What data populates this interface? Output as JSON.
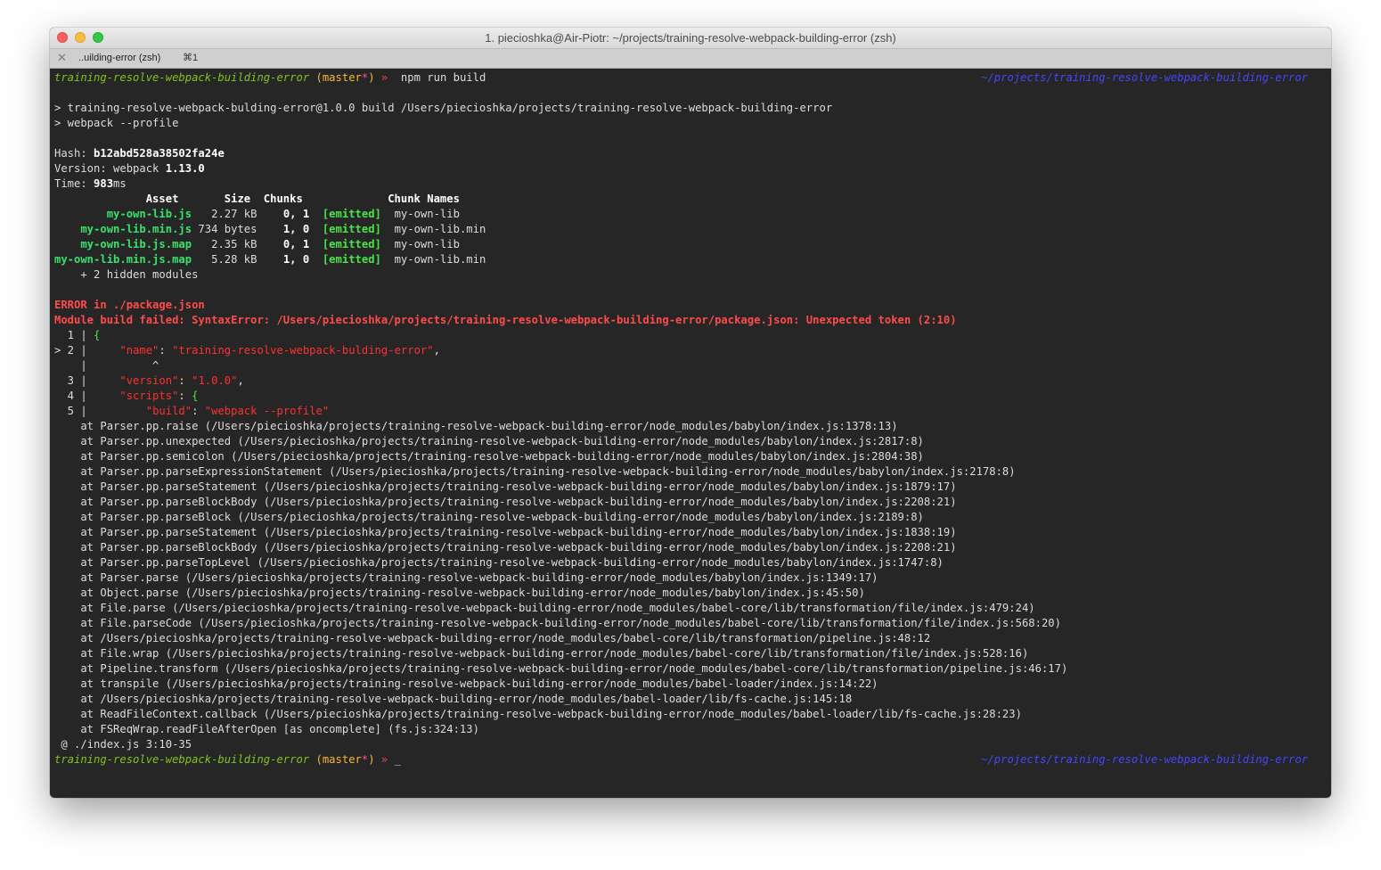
{
  "window": {
    "title": "1. piecioshka@Air-Piotr: ~/projects/training-resolve-webpack-building-error (zsh)"
  },
  "tab": {
    "close": "✕",
    "label": "..uilding-error (zsh)",
    "shortcut": "⌘1"
  },
  "prompt": {
    "dir": "training-resolve-webpack-building-error",
    "branch_open": " (master",
    "dirty": "*",
    "branch_close": ")",
    "arrow": " »",
    "right_path": "~/projects/training-resolve-webpack-building-error",
    "command": "  npm run build"
  },
  "npm": {
    "line1": "> training-resolve-webpack-bulding-error@1.0.0 build /Users/piecioshka/projects/training-resolve-webpack-building-error",
    "line2": "> webpack --profile"
  },
  "stats": {
    "hash_label": "Hash: ",
    "hash": "b12abd528a38502fa24e",
    "version_label": "Version: webpack ",
    "version": "1.13.0",
    "time_label": "Time: ",
    "time_value": "983",
    "time_unit": "ms",
    "header": "              Asset       Size  Chunks             Chunk Names",
    "assets": [
      {
        "name": "        my-own-lib.js",
        "size": "   2.27 kB",
        "chunks": "    0, 1",
        "emitted": "  [emitted]",
        "chunk_name": "  my-own-lib"
      },
      {
        "name": "    my-own-lib.min.js",
        "size": " 734 bytes",
        "chunks": "    1, 0",
        "emitted": "  [emitted]",
        "chunk_name": "  my-own-lib.min"
      },
      {
        "name": "    my-own-lib.js.map",
        "size": "   2.35 kB",
        "chunks": "    0, 1",
        "emitted": "  [emitted]",
        "chunk_name": "  my-own-lib"
      },
      {
        "name": "my-own-lib.min.js.map",
        "size": "   5.28 kB",
        "chunks": "    1, 0",
        "emitted": "  [emitted]",
        "chunk_name": "  my-own-lib.min"
      }
    ],
    "hidden_modules": "    + 2 hidden modules"
  },
  "error": {
    "title": "ERROR in ./package.json",
    "message": "Module build failed: SyntaxError: /Users/piecioshka/projects/training-resolve-webpack-building-error/package.json: Unexpected token (2:10)",
    "code": {
      "l1_prefix": "  1 | ",
      "l1_brace": "{",
      "l2_prefix": "> 2 |     ",
      "l2_key": "\"name\"",
      "l2_colon": ": ",
      "l2_value": "\"training-resolve-webpack-bulding-error\"",
      "l2_end": ",",
      "caret": "    |          ^",
      "l3_prefix": "  3 |     ",
      "l3_key": "\"version\"",
      "l3_colon": ": ",
      "l3_value": "\"1.0.0\"",
      "l3_end": ",",
      "l4_prefix": "  4 |     ",
      "l4_key": "\"scripts\"",
      "l4_colon": ": ",
      "l4_brace": "{",
      "l5_prefix": "  5 |         ",
      "l5_key": "\"build\"",
      "l5_colon": ": ",
      "l5_value": "\"webpack --profile\""
    },
    "stack": [
      "    at Parser.pp.raise (/Users/piecioshka/projects/training-resolve-webpack-building-error/node_modules/babylon/index.js:1378:13)",
      "    at Parser.pp.unexpected (/Users/piecioshka/projects/training-resolve-webpack-building-error/node_modules/babylon/index.js:2817:8)",
      "    at Parser.pp.semicolon (/Users/piecioshka/projects/training-resolve-webpack-building-error/node_modules/babylon/index.js:2804:38)",
      "    at Parser.pp.parseExpressionStatement (/Users/piecioshka/projects/training-resolve-webpack-building-error/node_modules/babylon/index.js:2178:8)",
      "    at Parser.pp.parseStatement (/Users/piecioshka/projects/training-resolve-webpack-building-error/node_modules/babylon/index.js:1879:17)",
      "    at Parser.pp.parseBlockBody (/Users/piecioshka/projects/training-resolve-webpack-building-error/node_modules/babylon/index.js:2208:21)",
      "    at Parser.pp.parseBlock (/Users/piecioshka/projects/training-resolve-webpack-building-error/node_modules/babylon/index.js:2189:8)",
      "    at Parser.pp.parseStatement (/Users/piecioshka/projects/training-resolve-webpack-building-error/node_modules/babylon/index.js:1838:19)",
      "    at Parser.pp.parseBlockBody (/Users/piecioshka/projects/training-resolve-webpack-building-error/node_modules/babylon/index.js:2208:21)",
      "    at Parser.pp.parseTopLevel (/Users/piecioshka/projects/training-resolve-webpack-building-error/node_modules/babylon/index.js:1747:8)",
      "    at Parser.parse (/Users/piecioshka/projects/training-resolve-webpack-building-error/node_modules/babylon/index.js:1349:17)",
      "    at Object.parse (/Users/piecioshka/projects/training-resolve-webpack-building-error/node_modules/babylon/index.js:45:50)",
      "    at File.parse (/Users/piecioshka/projects/training-resolve-webpack-building-error/node_modules/babel-core/lib/transformation/file/index.js:479:24)",
      "    at File.parseCode (/Users/piecioshka/projects/training-resolve-webpack-building-error/node_modules/babel-core/lib/transformation/file/index.js:568:20)",
      "    at /Users/piecioshka/projects/training-resolve-webpack-building-error/node_modules/babel-core/lib/transformation/pipeline.js:48:12",
      "    at File.wrap (/Users/piecioshka/projects/training-resolve-webpack-building-error/node_modules/babel-core/lib/transformation/file/index.js:528:16)",
      "    at Pipeline.transform (/Users/piecioshka/projects/training-resolve-webpack-building-error/node_modules/babel-core/lib/transformation/pipeline.js:46:17)",
      "    at transpile (/Users/piecioshka/projects/training-resolve-webpack-building-error/node_modules/babel-loader/index.js:14:22)",
      "    at /Users/piecioshka/projects/training-resolve-webpack-building-error/node_modules/babel-loader/lib/fs-cache.js:145:18",
      "    at ReadFileContext.callback (/Users/piecioshka/projects/training-resolve-webpack-building-error/node_modules/babel-loader/lib/fs-cache.js:28:23)",
      "    at FSReqWrap.readFileAfterOpen [as oncomplete] (fs.js:324:13)"
    ],
    "origin": " @ ./index.js 3:10-35"
  },
  "cursor": "_",
  "colors": {
    "background": "#262626",
    "prompt_dir": "#7fc61a",
    "branch": "#fbb92c",
    "error": "#ff4b4b",
    "asset": "#37e36c",
    "right_path": "#4646ff"
  }
}
